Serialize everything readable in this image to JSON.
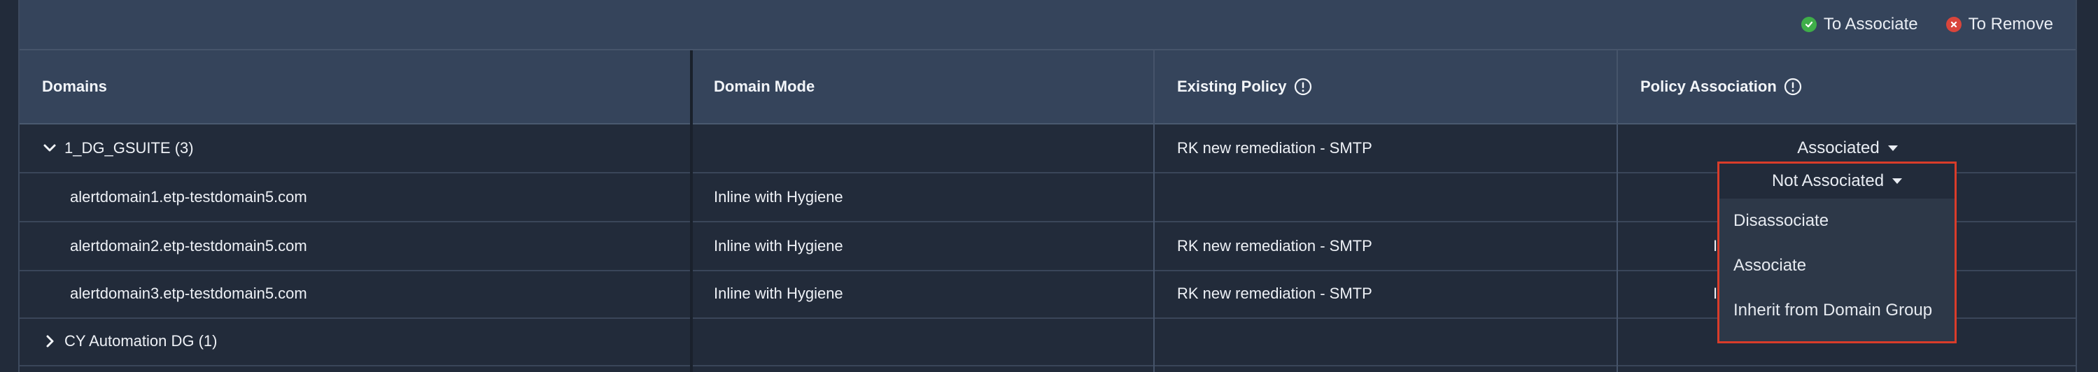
{
  "legend": {
    "associate_label": "To Associate",
    "remove_label": "To Remove",
    "associate_color": "#3fae49",
    "remove_color": "#d9453b"
  },
  "headers": {
    "domains": "Domains",
    "domain_mode": "Domain Mode",
    "existing_policy": "Existing Policy",
    "policy_association": "Policy Association"
  },
  "rows": [
    {
      "domain": "1_DG_GSUITE (3)",
      "mode": "",
      "policy": "RK new remediation - SMTP",
      "association": "Associated"
    },
    {
      "domain": "alertdomain1.etp-testdomain5.com",
      "mode": "Inline with Hygiene",
      "policy": "",
      "association": "Not Associated"
    },
    {
      "domain": "alertdomain2.etp-testdomain5.com",
      "mode": "Inline with Hygiene",
      "policy": "RK new remediation - SMTP",
      "association": "I"
    },
    {
      "domain": "alertdomain3.etp-testdomain5.com",
      "mode": "Inline with Hygiene",
      "policy": "RK new remediation - SMTP",
      "association": "I"
    },
    {
      "domain": "CY Automation DG (1)",
      "mode": "",
      "policy": "",
      "association": ""
    }
  ],
  "dropdown": {
    "selected": "Not Associated",
    "options": [
      "Disassociate",
      "Associate",
      "Inherit from Domain Group"
    ]
  }
}
